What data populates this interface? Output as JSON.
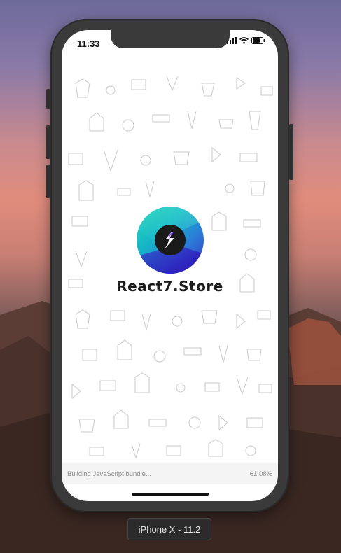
{
  "status_bar": {
    "time": "11:33"
  },
  "app": {
    "brand_name": "React7.Store"
  },
  "bundle": {
    "message": "Building JavaScript bundle...",
    "progress_text": "61.08%",
    "progress": 0.6108
  },
  "device": {
    "label": "iPhone X - 11.2"
  },
  "icons": {
    "wifi": "wifi-icon",
    "battery": "battery-icon",
    "cell": "signal-icon",
    "logo": "lightning-logo-icon"
  },
  "colors": {
    "logo_teal": "#2bd4b0",
    "logo_blue": "#2a7fd8",
    "logo_indigo": "#3b2fc8"
  }
}
